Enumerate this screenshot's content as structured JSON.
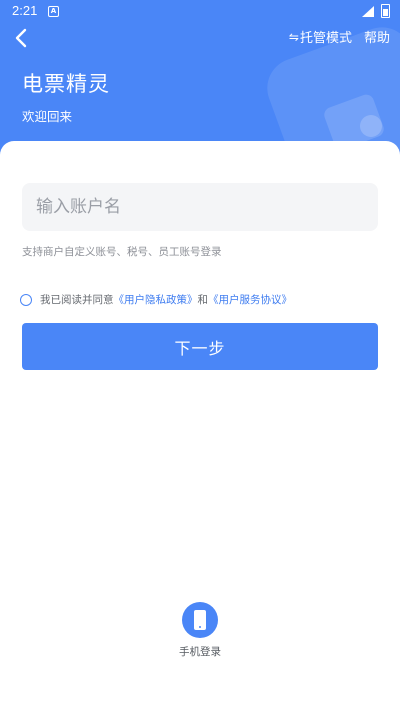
{
  "status_bar": {
    "time": "2:21",
    "notification_icon": "A"
  },
  "header": {
    "back_icon": "chevron-left",
    "hosting_mode_label": "托管模式",
    "hosting_mode_icon": "⇋",
    "help_label": "帮助",
    "title": "电票精灵",
    "subtitle": "欢迎回来",
    "background_color": "#4a86f7"
  },
  "login": {
    "account_placeholder": "输入账户名",
    "account_value": "",
    "hint": "支持商户自定义账号、税号、员工账号登录",
    "agreement": {
      "checked": false,
      "prefix": "我已阅读并同意",
      "privacy_link": "《用户隐私政策》",
      "conjunction": "和",
      "service_link": "《用户服务协议》"
    },
    "next_button_label": "下一步"
  },
  "alt_login": {
    "phone_label": "手机登录",
    "phone_icon": "mobile-phone"
  }
}
